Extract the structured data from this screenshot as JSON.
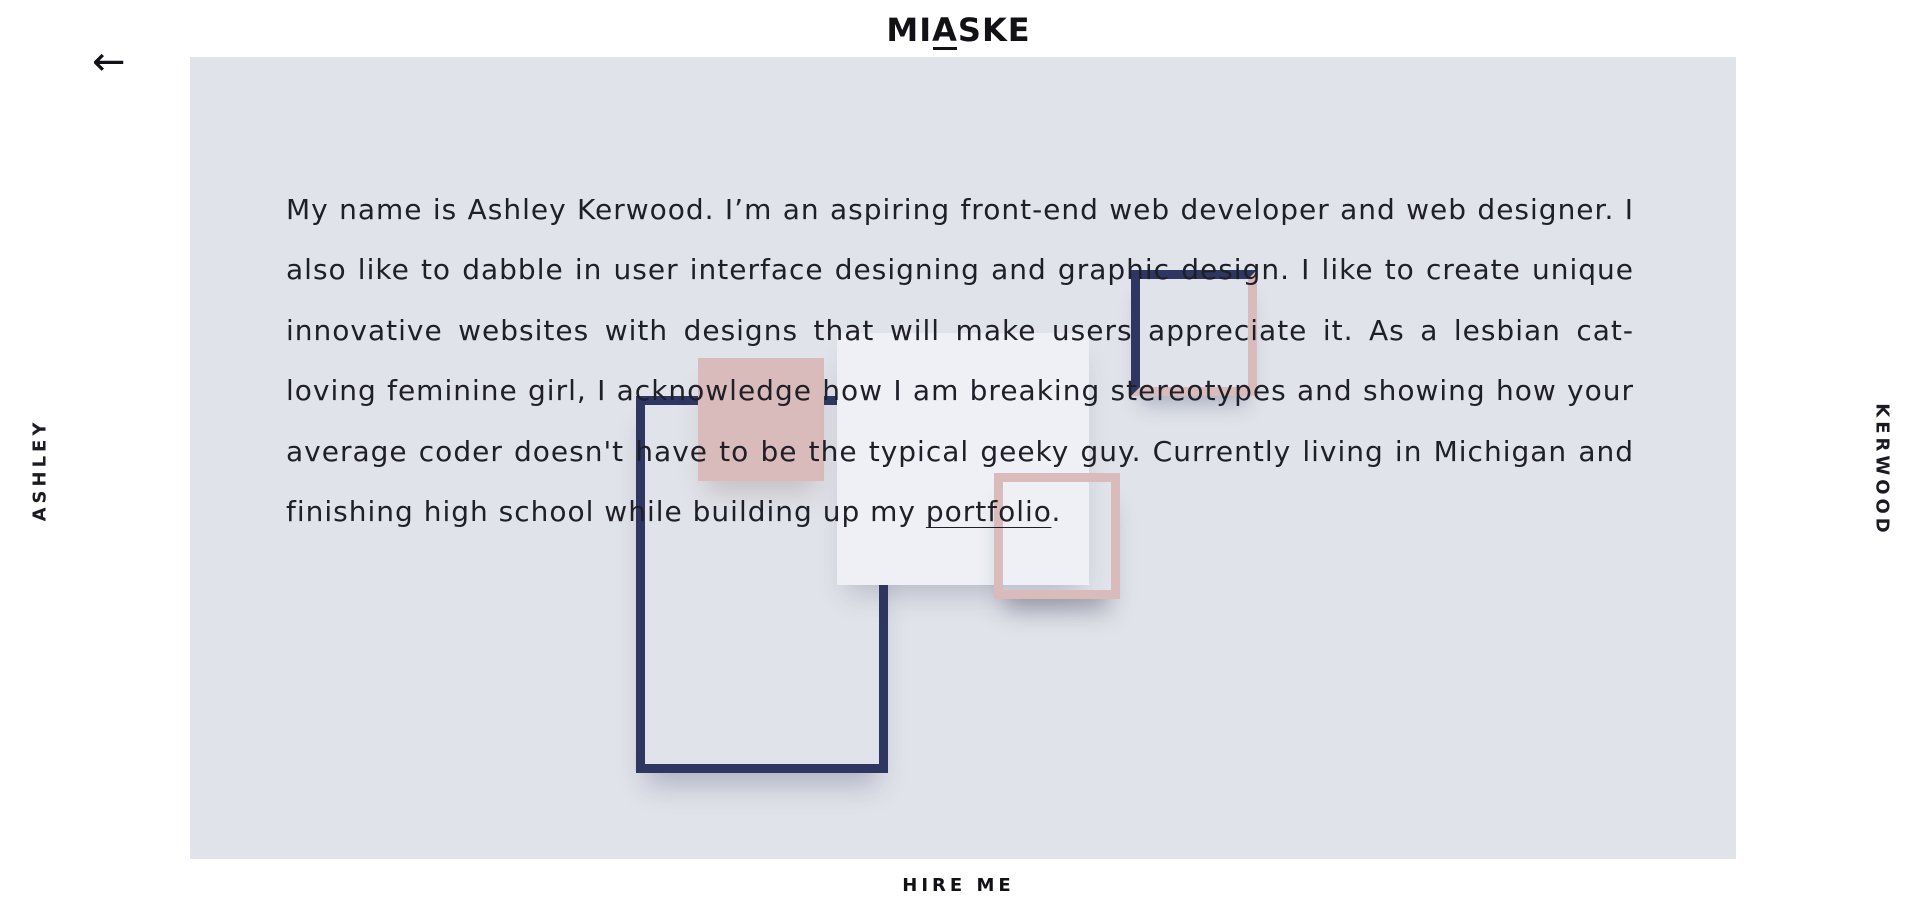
{
  "header": {
    "logo_prefix": "MI",
    "logo_mark": "A",
    "logo_suffix": "SKE",
    "back_icon": "←"
  },
  "side": {
    "left_label": "ASHLEY",
    "right_label": "KERWOOD"
  },
  "bio": {
    "text_before_link": "My name is Ashley Kerwood. I’m an aspiring front-end web developer and web designer. I also like to dabble in user interface designing and graphic design. I like to create unique innovative websites with designs that will make users appreciate it. As a lesbian cat-loving feminine girl, I acknowledge how I am breaking stereotypes and showing how your average coder doesn't have to be the typical geeky guy. Currently living in Michigan and finishing high school while building up my ",
    "link_label": "portfolio",
    "text_after_link": "."
  },
  "footer": {
    "hire_label": "HIRE ME"
  },
  "colors": {
    "panel_background": "#e1e3ea",
    "navy": "#2d3762",
    "pink": "#dabbbb",
    "light_block": "#eef0f6",
    "text": "#1f1f27"
  },
  "icons": {
    "back": "arrow-left-icon"
  }
}
